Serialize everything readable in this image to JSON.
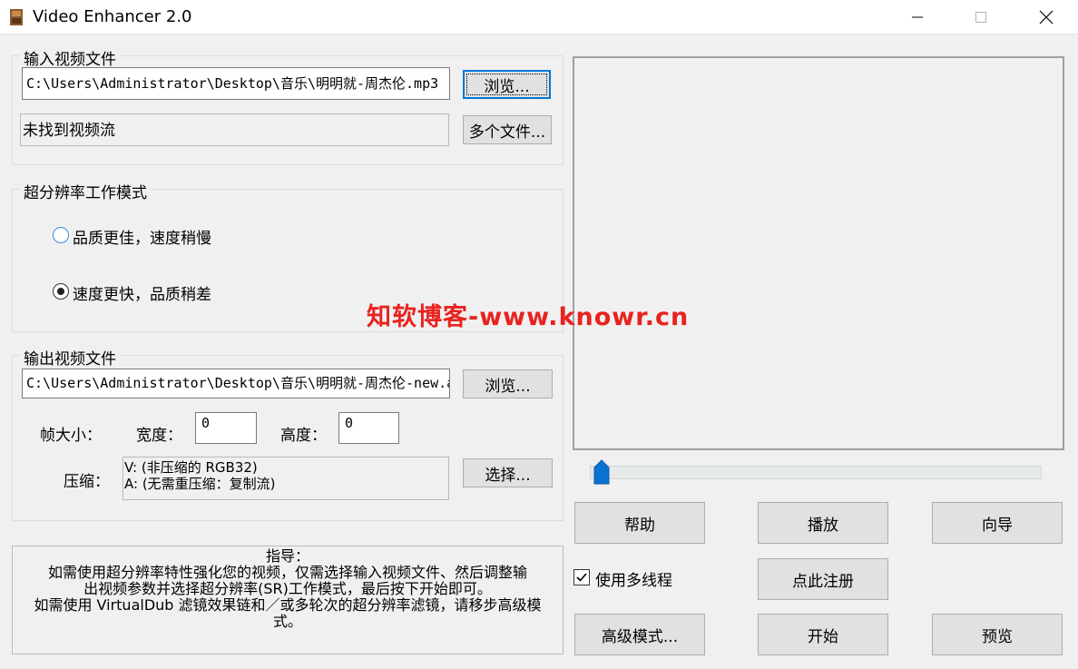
{
  "window": {
    "title": "Video Enhancer 2.0",
    "controls": {
      "minimize_icon": "minimize-icon",
      "maximize_icon": "maximize-icon",
      "close_icon": "close-icon"
    }
  },
  "input_group": {
    "legend": "输入视频文件",
    "path_value": "C:\\Users\\Administrator\\Desktop\\音乐\\明明就-周杰伦.mp3",
    "browse_label": "浏览...",
    "status_text": "未找到视频流",
    "multi_files_label": "多个文件..."
  },
  "mode_group": {
    "legend": "超分辨率工作模式",
    "options": [
      {
        "label": "品质更佳，速度稍慢",
        "selected": false
      },
      {
        "label": "速度更快，品质稍差",
        "selected": true
      }
    ]
  },
  "output_group": {
    "legend": "输出视频文件",
    "path_value": "C:\\Users\\Administrator\\Desktop\\音乐\\明明就-周杰伦-new.avi",
    "browse_label": "浏览...",
    "frame_size_label": "帧大小：",
    "width_label": "宽度：",
    "width_value": "0",
    "height_label": "高度：",
    "height_value": "0",
    "compress_label": "压缩：",
    "compress_lines": [
      "V: (非压缩的 RGB32)",
      "A: (无需重压缩：复制流)"
    ],
    "choose_label": "选择..."
  },
  "guide": {
    "title": "指导：",
    "lines": [
      "如需使用超分辨率特性强化您的视频，仅需选择输入视频文件、然后调整输",
      "出视频参数并选择超分辨率(SR)工作模式，最后按下开始即可。",
      "如需使用 VirtualDub 滤镜效果链和／或多轮次的超分辨率滤镜，请移步高级模",
      "式。"
    ]
  },
  "watermark": "知软博客-www.knowr.cn",
  "slider": {
    "position": 0
  },
  "buttons": {
    "help": "帮助",
    "play": "播放",
    "wizard": "向导",
    "register": "点此注册",
    "advanced": "高级模式...",
    "start": "开始",
    "preview": "预览"
  },
  "multithread": {
    "label": "使用多线程",
    "checked": true
  },
  "colors": {
    "focus_border": "#0078d7",
    "watermark": "#e8231f",
    "slider_thumb": "#0a72d1"
  }
}
